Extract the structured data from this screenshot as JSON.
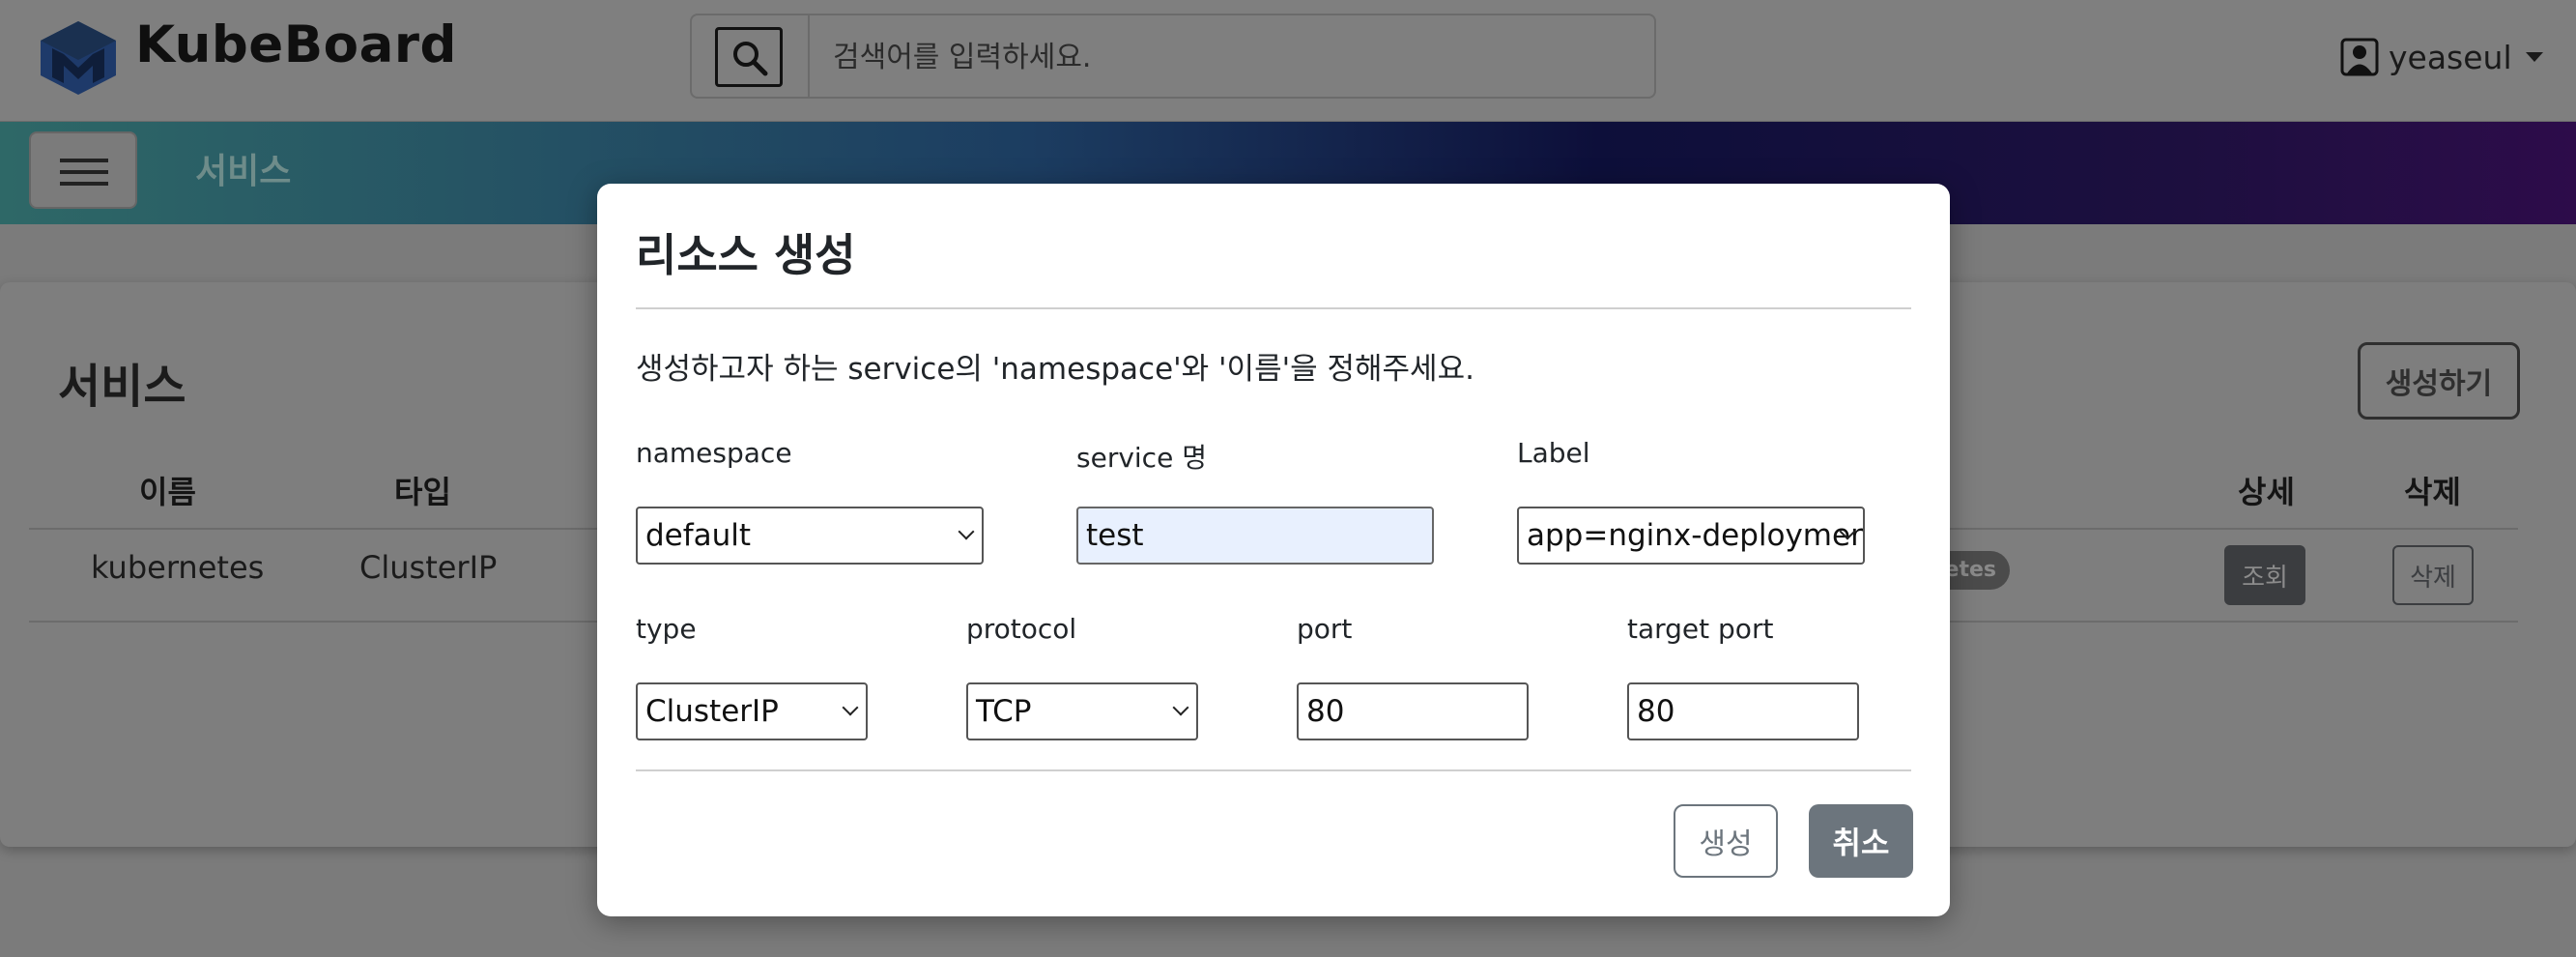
{
  "header": {
    "brand": "KubeBoard",
    "search_placeholder": "검색어를 입력하세요.",
    "user": "yeaseul"
  },
  "nav": {
    "title": "서비스"
  },
  "page": {
    "title": "서비스",
    "create_button": "생성하기",
    "columns": {
      "name": "이름",
      "type": "타입",
      "detail": "상세",
      "delete": "삭제"
    },
    "rows": [
      {
        "name": "kubernetes",
        "type": "ClusterIP",
        "badge": "etes",
        "detail_button": "조회",
        "delete_button": "삭제"
      }
    ]
  },
  "modal": {
    "title": "리소스 생성",
    "description": "생성하고자 하는 service의 'namespace'와 '이름'을 정해주세요.",
    "fields": {
      "namespace": {
        "label": "namespace",
        "value": "default"
      },
      "service_name": {
        "label": "service 명",
        "value": "test"
      },
      "label": {
        "label": "Label",
        "value": "app=nginx-deployment"
      },
      "type": {
        "label": "type",
        "value": "ClusterIP"
      },
      "protocol": {
        "label": "protocol",
        "value": "TCP"
      },
      "port": {
        "label": "port",
        "value": "80"
      },
      "target_port": {
        "label": "target port",
        "value": "80"
      }
    },
    "submit_button": "생성",
    "cancel_button": "취소"
  },
  "colors": {
    "overlay": "#7b7b7b",
    "nav_gradient_start": "#2e6867",
    "nav_gradient_end": "#2d0c4a",
    "secondary": "#6c757d",
    "autofill": "#e8f0fe"
  }
}
